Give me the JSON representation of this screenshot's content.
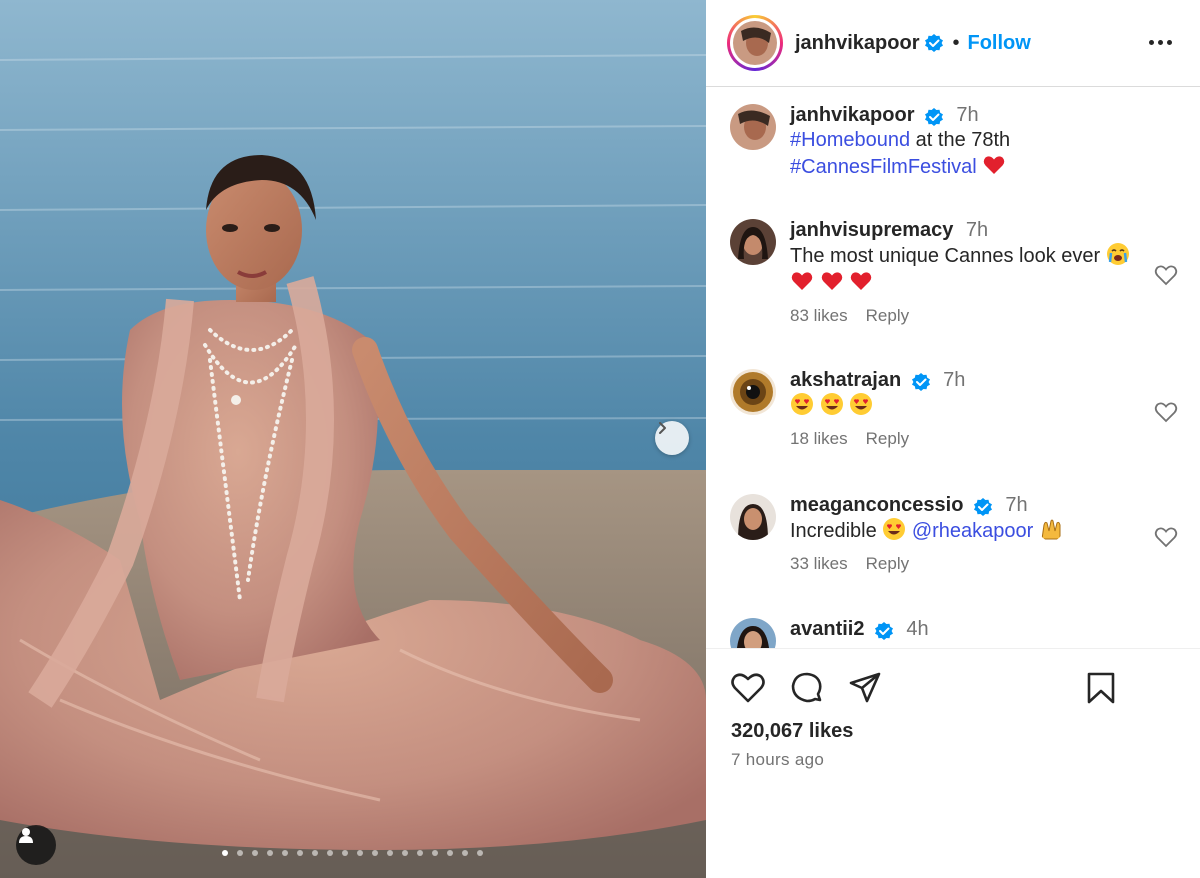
{
  "header": {
    "username": "janhvikapoor",
    "separator": "•",
    "follow_label": "Follow"
  },
  "caption": {
    "username": "janhvikapoor",
    "time": "7h",
    "hashtag1": "#Homebound",
    "text_mid": " at the 78th",
    "hashtag2": "#CannesFilmFestival"
  },
  "comments": [
    {
      "username": "janhvisupremacy",
      "time": "7h",
      "text": "The most unique Cannes look ever",
      "likes": "83 likes",
      "reply": "Reply"
    },
    {
      "username": "akshatrajan",
      "time": "7h",
      "text": "",
      "likes": "18 likes",
      "reply": "Reply"
    },
    {
      "username": "meaganconcessio",
      "time": "7h",
      "text": "Incredible",
      "mention": "@rheakapoor",
      "likes": "33 likes",
      "reply": "Reply"
    },
    {
      "username": "avantii2",
      "time": "4h"
    }
  ],
  "post": {
    "likes": "320,067 likes",
    "time_ago": "7 hours ago"
  },
  "carousel": {
    "total_slides": 18,
    "active_index": 0
  },
  "colors": {
    "link": "#0095f6",
    "hashtag": "#3b4ee0",
    "text": "#262626",
    "muted": "#737373"
  },
  "icons": [
    "verified-badge-icon",
    "more-options-icon",
    "heart-icon",
    "comment-icon",
    "share-icon",
    "bookmark-icon",
    "chevron-right-icon",
    "user-tag-icon"
  ]
}
